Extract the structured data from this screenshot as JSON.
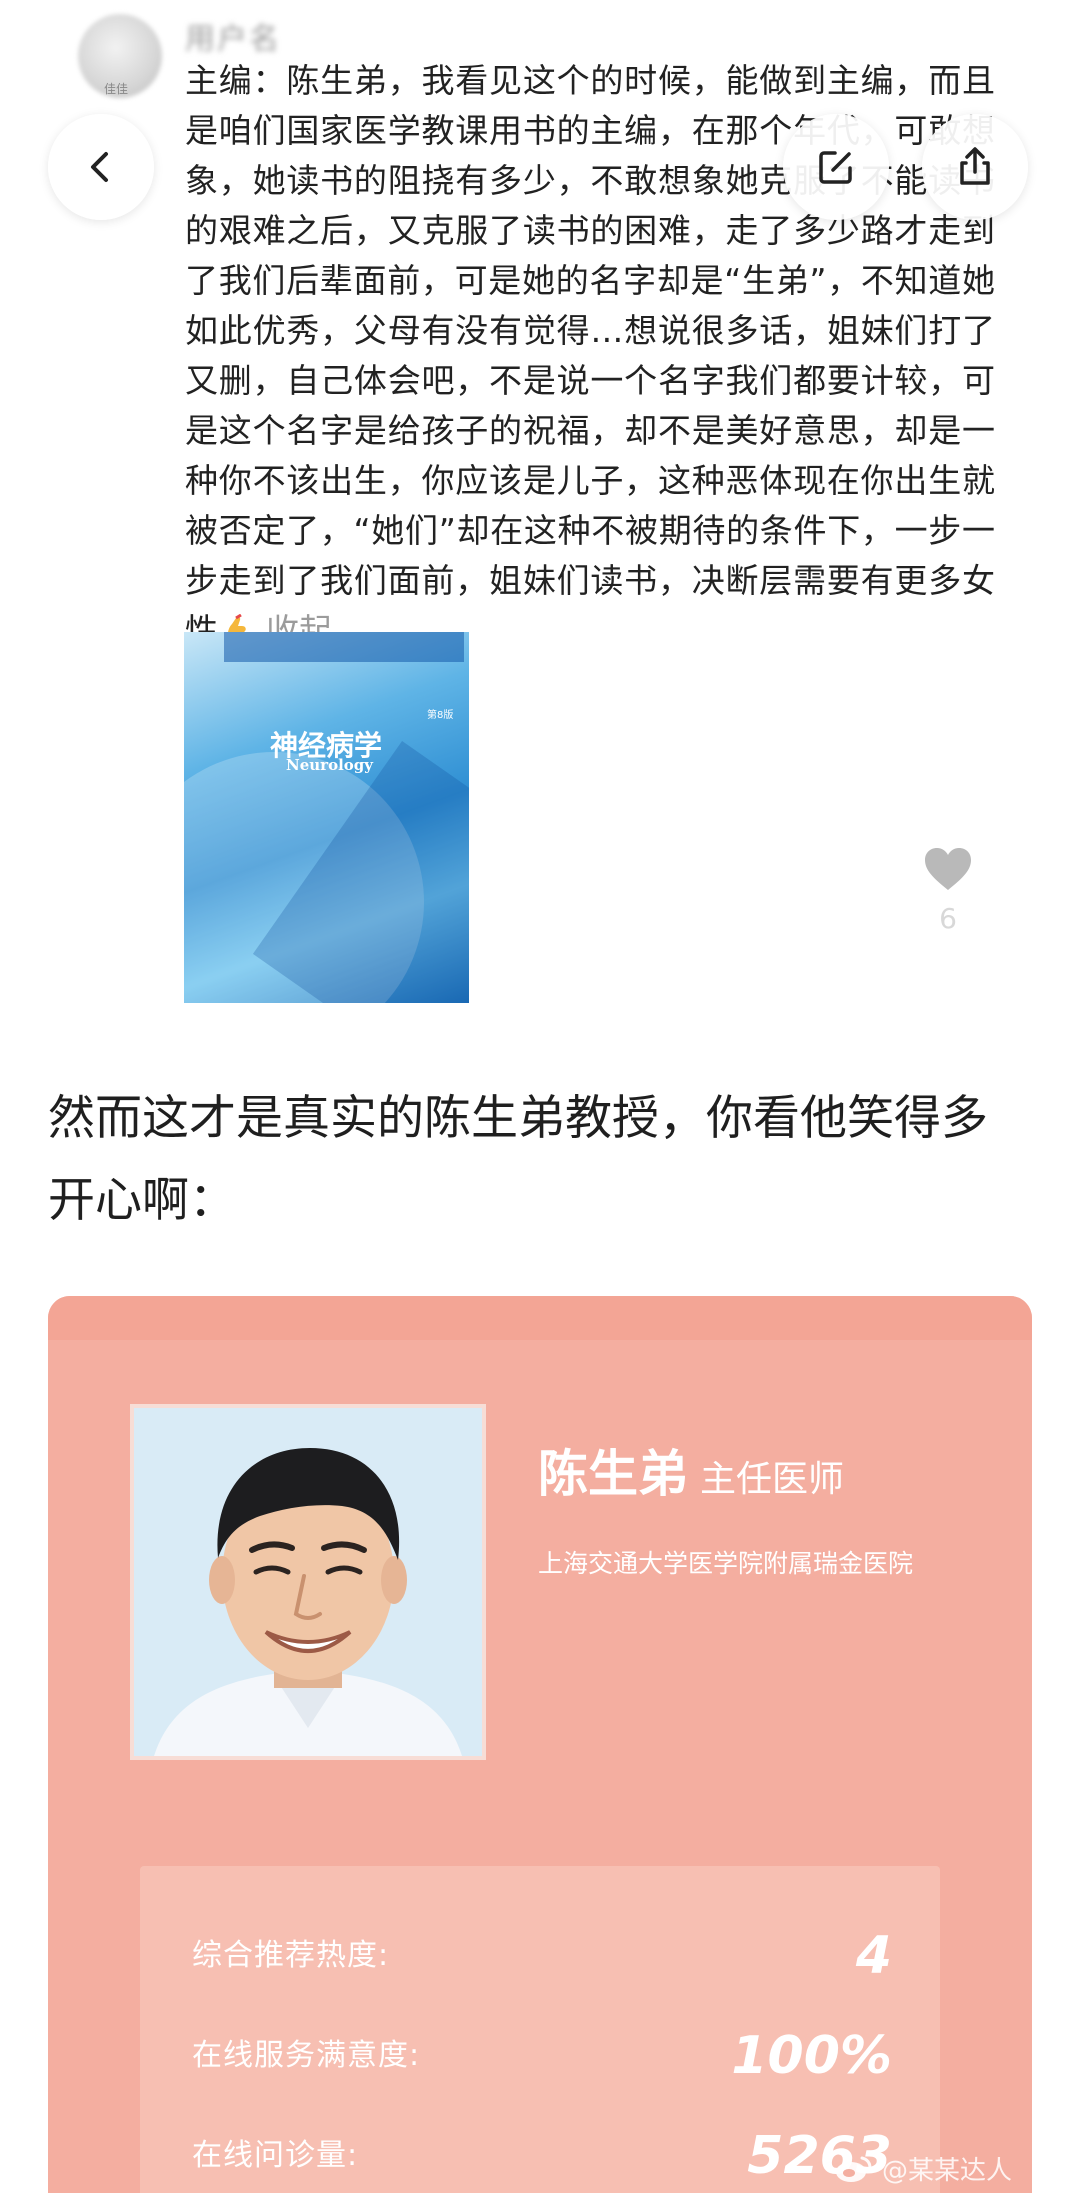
{
  "comment": {
    "username": "用户名",
    "avatar_tag": "佳佳",
    "text": "主编：陈生弟，我看见这个的时候，能做到主编，而且是咱们国家医学教课用书的主编，在那个年代，可敢想象，她读书的阻挠有多少，不敢想象她克服了不能读书的艰难之后，又克服了读书的困难，走了多少路才走到了我们后辈面前，可是她的名字却是“生弟”，不知道她如此优秀，父母有没有觉得…想说很多话，姐妹们打了又删，自己体会吧，不是说一个名字我们都要计较，可是这个名字是给孩子的祝福，却不是美好意思，却是一种你不该出生，你应该是儿子，这种恶体现在你出生就被否定了，“她们”却在这种不被期待的条件下，一步一步走到了我们面前，姐妹们读书，决断层需要有更多女性",
    "collapse_label": "收起",
    "like_count": "6"
  },
  "nav": {
    "back_icon": "chevron-left-icon",
    "edit_icon": "edit-icon",
    "share_icon": "share-icon"
  },
  "book": {
    "title": "神经病学",
    "subtitle": "Neurology",
    "edition": "第8版"
  },
  "article": {
    "text": "然而这才是真实的陈生弟教授，你看他笑得多开心啊："
  },
  "doctor": {
    "name": "陈生弟",
    "title": "主任医师",
    "hospital": "上海交通大学医学院附属瑞金医院",
    "stats": [
      {
        "label": "综合推荐热度:",
        "value": "4"
      },
      {
        "label": "在线服务满意度:",
        "value": "100%"
      },
      {
        "label": "在线问诊量:",
        "value": "5263"
      }
    ]
  },
  "watermark": {
    "text": "@某某达人"
  },
  "colors": {
    "card_bg": "#f4aea0",
    "stats_bg": "#f7bfb2",
    "text_dark": "#1f1f1f"
  }
}
